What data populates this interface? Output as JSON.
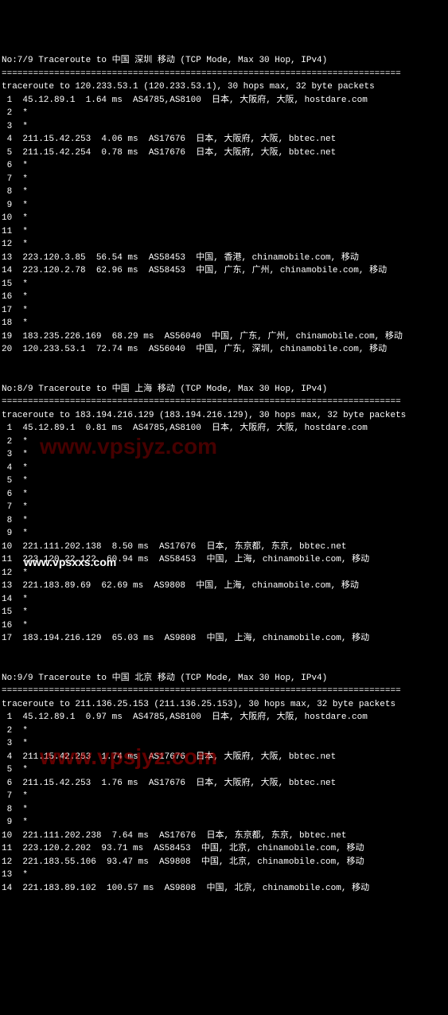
{
  "traces": [
    {
      "header": "No:7/9 Traceroute to 中国 深圳 移动 (TCP Mode, Max 30 Hop, IPv4)",
      "target_line": "traceroute to 120.233.53.1 (120.233.53.1), 30 hops max, 32 byte packets",
      "hops": [
        " 1  45.12.89.1  1.64 ms  AS4785,AS8100  日本, 大阪府, 大阪, hostdare.com",
        " 2  *",
        " 3  *",
        " 4  211.15.42.253  4.06 ms  AS17676  日本, 大阪府, 大阪, bbtec.net",
        " 5  211.15.42.254  0.78 ms  AS17676  日本, 大阪府, 大阪, bbtec.net",
        " 6  *",
        " 7  *",
        " 8  *",
        " 9  *",
        "10  *",
        "11  *",
        "12  *",
        "13  223.120.3.85  56.54 ms  AS58453  中国, 香港, chinamobile.com, 移动",
        "14  223.120.2.78  62.96 ms  AS58453  中国, 广东, 广州, chinamobile.com, 移动",
        "15  *",
        "16  *",
        "17  *",
        "18  *",
        "19  183.235.226.169  68.29 ms  AS56040  中国, 广东, 广州, chinamobile.com, 移动",
        "20  120.233.53.1  72.74 ms  AS56040  中国, 广东, 深圳, chinamobile.com, 移动"
      ]
    },
    {
      "header": "No:8/9 Traceroute to 中国 上海 移动 (TCP Mode, Max 30 Hop, IPv4)",
      "target_line": "traceroute to 183.194.216.129 (183.194.216.129), 30 hops max, 32 byte packets",
      "hops": [
        " 1  45.12.89.1  0.81 ms  AS4785,AS8100  日本, 大阪府, 大阪, hostdare.com",
        " 2  *",
        " 3  *",
        " 4  *",
        " 5  *",
        " 6  *",
        " 7  *",
        " 8  *",
        " 9  *",
        "10  221.111.202.138  8.50 ms  AS17676  日本, 东京都, 东京, bbtec.net",
        "11  223.120.22.122  60.94 ms  AS58453  中国, 上海, chinamobile.com, 移动",
        "12  *",
        "13  221.183.89.69  62.69 ms  AS9808  中国, 上海, chinamobile.com, 移动",
        "14  *",
        "15  *",
        "16  *",
        "17  183.194.216.129  65.03 ms  AS9808  中国, 上海, chinamobile.com, 移动"
      ]
    },
    {
      "header": "No:9/9 Traceroute to 中国 北京 移动 (TCP Mode, Max 30 Hop, IPv4)",
      "target_line": "traceroute to 211.136.25.153 (211.136.25.153), 30 hops max, 32 byte packets",
      "hops": [
        " 1  45.12.89.1  0.97 ms  AS4785,AS8100  日本, 大阪府, 大阪, hostdare.com",
        " 2  *",
        " 3  *",
        " 4  211.15.42.253  1.74 ms  AS17676  日本, 大阪府, 大阪, bbtec.net",
        " 5  *",
        " 6  211.15.42.253  1.76 ms  AS17676  日本, 大阪府, 大阪, bbtec.net",
        " 7  *",
        " 8  *",
        " 9  *",
        "10  221.111.202.238  7.64 ms  AS17676  日本, 东京都, 东京, bbtec.net",
        "11  223.120.2.202  93.71 ms  AS58453  中国, 北京, chinamobile.com, 移动",
        "12  221.183.55.106  93.47 ms  AS9808  中国, 北京, chinamobile.com, 移动",
        "13  *",
        "14  221.183.89.102  100.57 ms  AS9808  中国, 北京, chinamobile.com, 移动"
      ]
    }
  ],
  "divider": "============================================================================",
  "watermarks": {
    "w1": "www.vpsjyz.com",
    "w2": "www.vpsxxs.com",
    "w3": "www.vpsjyz.com"
  }
}
